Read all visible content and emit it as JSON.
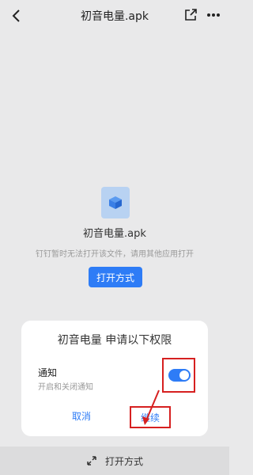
{
  "header": {
    "title": "初音电量.apk",
    "back_icon": "chevron-left-icon",
    "share_icon": "share-external-icon",
    "more_icon": "more-horizontal-icon"
  },
  "file": {
    "icon": "cube-file-icon",
    "name": "初音电量.apk",
    "hint": "钉钉暂时无法打开该文件，请用其他应用打开",
    "open_button": "打开方式"
  },
  "dialog": {
    "title": "初音电量 申请以下权限",
    "permission": {
      "name": "通知",
      "desc": "开启和关闭通知",
      "enabled": true
    },
    "cancel": "取消",
    "continue": "继续",
    "annotation_color": "#d62020"
  },
  "bottom_bar": {
    "icon": "expand-arrows-icon",
    "label": "打开方式"
  },
  "colors": {
    "accent": "#2e7cf6",
    "background": "#e9e9ea"
  }
}
